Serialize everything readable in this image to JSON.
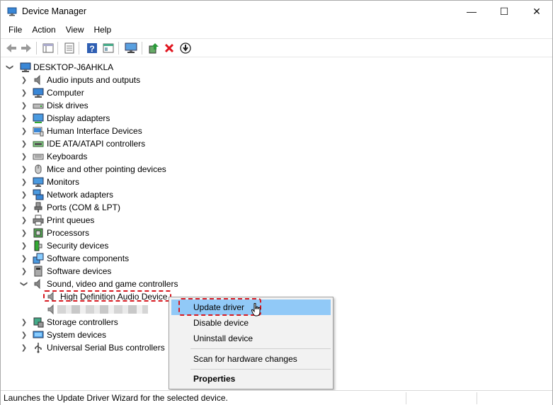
{
  "window": {
    "title": "Device Manager",
    "controls": {
      "minimize": "—",
      "maximize": "☐",
      "close": "✕"
    }
  },
  "menu": [
    "File",
    "Action",
    "View",
    "Help"
  ],
  "toolbar": [
    "back-icon",
    "forward-icon",
    "show-hide-console-tree-icon",
    "properties-icon",
    "help-icon",
    "view-icon",
    "monitor-icon",
    "update-driver-icon",
    "uninstall-icon",
    "download-icon"
  ],
  "tree": {
    "root": "DESKTOP-J6AHKLA",
    "categories": [
      {
        "label": "Audio inputs and outputs",
        "icon": "speaker-icon"
      },
      {
        "label": "Computer",
        "icon": "computer-icon"
      },
      {
        "label": "Disk drives",
        "icon": "disk-drive-icon"
      },
      {
        "label": "Display adapters",
        "icon": "display-adapter-icon"
      },
      {
        "label": "Human Interface Devices",
        "icon": "hid-icon"
      },
      {
        "label": "IDE ATA/ATAPI controllers",
        "icon": "ide-controller-icon"
      },
      {
        "label": "Keyboards",
        "icon": "keyboard-icon"
      },
      {
        "label": "Mice and other pointing devices",
        "icon": "mouse-icon"
      },
      {
        "label": "Monitors",
        "icon": "monitor-icon"
      },
      {
        "label": "Network adapters",
        "icon": "network-adapter-icon"
      },
      {
        "label": "Ports (COM & LPT)",
        "icon": "port-icon"
      },
      {
        "label": "Print queues",
        "icon": "printer-icon"
      },
      {
        "label": "Processors",
        "icon": "processor-icon"
      },
      {
        "label": "Security devices",
        "icon": "security-device-icon"
      },
      {
        "label": "Software components",
        "icon": "software-component-icon"
      },
      {
        "label": "Software devices",
        "icon": "software-device-icon"
      },
      {
        "label": "Sound, video and game controllers",
        "icon": "speaker-icon",
        "expanded": true
      }
    ],
    "sound_children": [
      "High Definition Audio Device"
    ],
    "after": [
      {
        "label": "Storage controllers",
        "icon": "storage-icon"
      },
      {
        "label": "System devices",
        "icon": "system-device-icon"
      },
      {
        "label": "Universal Serial Bus controllers",
        "icon": "usb-icon"
      }
    ]
  },
  "context_menu": {
    "items": [
      "Update driver",
      "Disable device",
      "Uninstall device",
      "Scan for hardware changes",
      "Properties"
    ],
    "highlighted": "Update driver",
    "highlight_color": "#91c9f7",
    "annotation_color": "#d71920"
  },
  "status": {
    "text": "Launches the Update Driver Wizard for the selected device."
  }
}
